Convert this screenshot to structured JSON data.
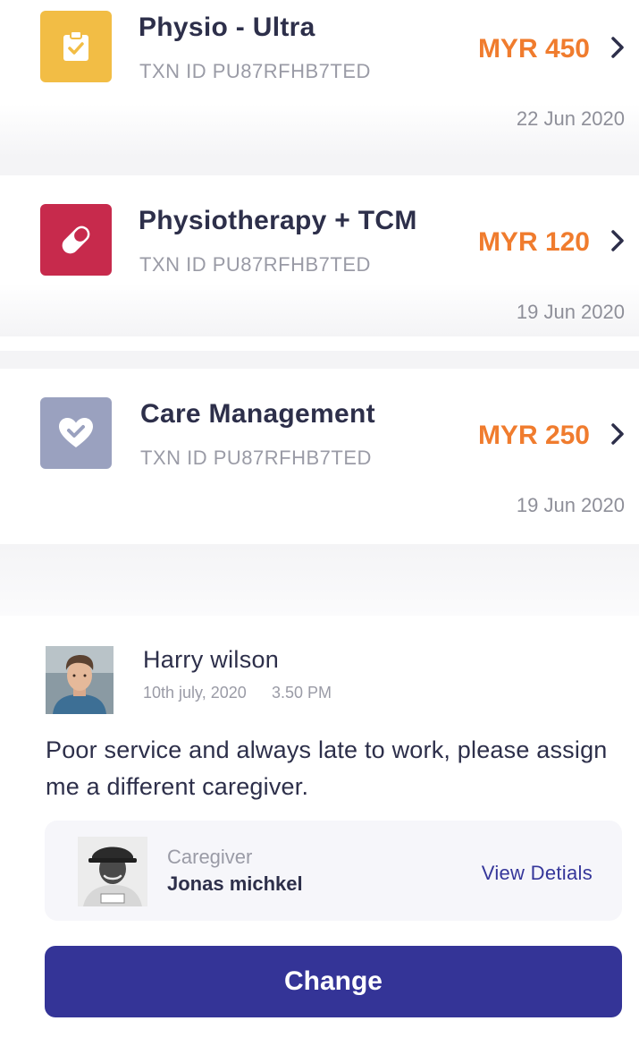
{
  "transactions": [
    {
      "title": "Physio - Ultra",
      "txn_id": "TXN ID PU87RFHB7TED",
      "amount": "MYR 450",
      "date": "22 Jun 2020",
      "icon": "clipboard-check-icon",
      "icon_color": "#f2bd45"
    },
    {
      "title": "Physiotherapy + TCM",
      "txn_id": "TXN ID PU87RFHB7TED",
      "amount": "MYR 120",
      "date": "19 Jun 2020",
      "icon": "pill-icon",
      "icon_color": "#c72a4c"
    },
    {
      "title": "Care Management",
      "txn_id": "TXN ID PU87RFHB7TED",
      "amount": "MYR 250",
      "date": "19 Jun 2020",
      "icon": "heart-check-icon",
      "icon_color": "#9aa1bf"
    }
  ],
  "review": {
    "author": "Harry wilson",
    "date": "10th july, 2020",
    "time": "3.50 PM",
    "text": "Poor service and always late to work, please assign me a different caregiver."
  },
  "caregiver": {
    "label": "Caregiver",
    "name": "Jonas michkel",
    "link_label": "View Detials"
  },
  "actions": {
    "change_label": "Change"
  },
  "colors": {
    "accent": "#343497",
    "amount": "#f07c2e",
    "text_primary": "#2d2f4a",
    "text_muted": "#9a9ba6"
  }
}
